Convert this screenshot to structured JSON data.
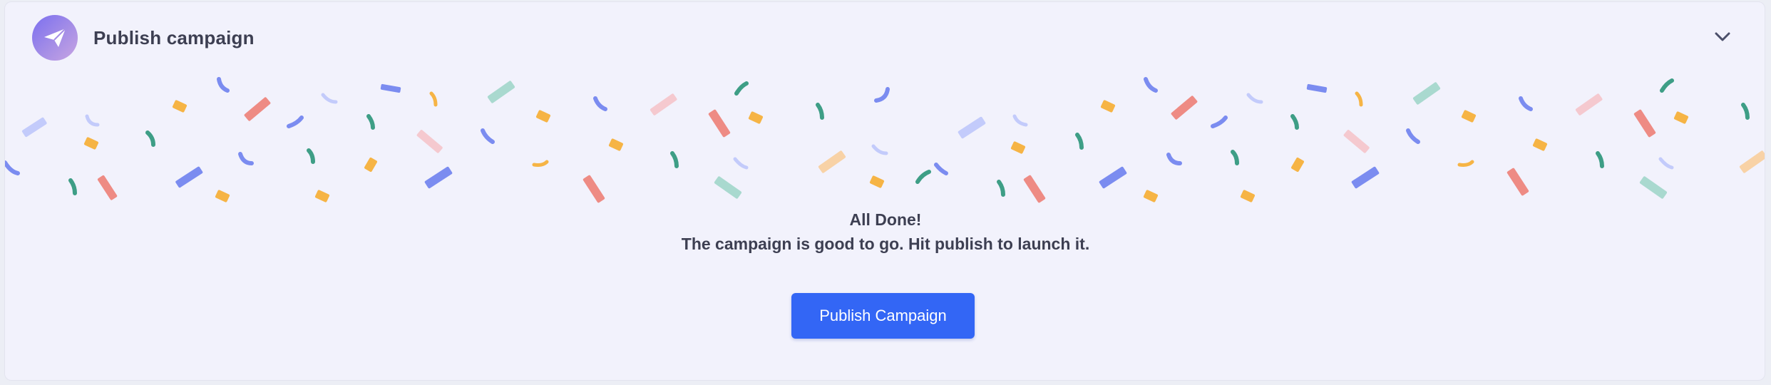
{
  "header": {
    "title": "Publish campaign",
    "icon": "paper-plane-icon",
    "collapse_icon": "chevron-down-icon"
  },
  "message": {
    "heading": "All Done!",
    "body": "The campaign is good to go. Hit publish to launch it."
  },
  "actions": {
    "publish_label": "Publish Campaign"
  },
  "colors": {
    "primary": "#3366f5",
    "background": "#f2f2fc",
    "text": "#3d3f52",
    "avatar_gradient": [
      "#7b6ff0",
      "#c7a4e3"
    ],
    "confetti": [
      "#7b8cf0",
      "#ee8b84",
      "#f6b445",
      "#3e9e86",
      "#b9c3fb",
      "#f5c9cf",
      "#a9d9cf",
      "#f8d2a6"
    ]
  }
}
